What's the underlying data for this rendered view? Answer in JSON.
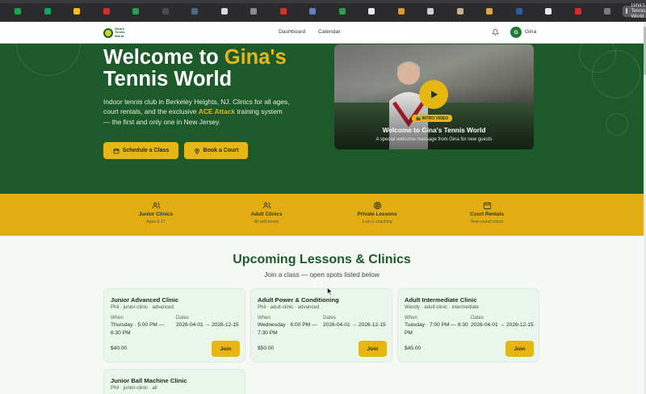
{
  "browser": {
    "active_tab_title": "Gina's Tennis World...",
    "tab_favicons": [
      "#1aa64a",
      "#0fa55a",
      "#f4c20d",
      "#d62b2b",
      "#2a9a55",
      "#4a4a52",
      "#4a6a8a",
      "#d9d9d9",
      "#8a8a8a",
      "#d93025",
      "#5e7fc2",
      "#2f9e4a",
      "#eaeaea",
      "#d89b2a",
      "#cfcfcf",
      "#c9b08a",
      "#e2a93a",
      "#2a5e9e",
      "#e8e8e8",
      "#d62b2b",
      "#7a7a7a"
    ]
  },
  "header": {
    "logo_text": "Gina's Tennis World",
    "nav": [
      "Dashboard",
      "Calendar"
    ],
    "user_initial": "G",
    "user_name": "Gina"
  },
  "hero": {
    "title_white_1": "Welcome to ",
    "title_accent": "Gina's",
    "title_white_2": "Tennis World",
    "desc_before": "Indoor tennis club in Berkeley Heights, NJ. Clinics for all ages, court rentals, and the exclusive ",
    "desc_highlight": "ACE Attack",
    "desc_after": " training system — the first and only one in New Jersey.",
    "btn_schedule": "Schedule a Class",
    "btn_court": "Book a Court",
    "video_badge": "🎬 INTRO VIDEO",
    "video_title": "Welcome to Gina's Tennis World",
    "video_subtitle": "A special welcome message from Gina for new guests"
  },
  "features": [
    {
      "title": "Junior Clinics",
      "sub": "Ages 6-17",
      "icon": "users-icon"
    },
    {
      "title": "Adult Clinics",
      "sub": "All skill levels",
      "icon": "users-icon"
    },
    {
      "title": "Private Lessons",
      "sub": "1-on-1 coaching",
      "icon": "target-icon"
    },
    {
      "title": "Court Rentals",
      "sub": "Year-round indoor",
      "icon": "calendar-icon"
    }
  ],
  "lessons": {
    "heading": "Upcoming Lessons & Clinics",
    "subheading": "Join a class — open spots listed below",
    "when_label": "When",
    "dates_label": "Dates",
    "join_label": "Join",
    "cards": [
      {
        "title": "Junior Advanced Clinic",
        "meta": "Phil · junior-clinic · advanced",
        "when": "Thursday · 5:00 PM — 6:30 PM",
        "dates": "2026-04-01 → 2026-12-15",
        "price": "$40.00"
      },
      {
        "title": "Adult Power & Conditioning",
        "meta": "Phil · adult-clinic · advanced",
        "when": "Wednesday · 6:00 PM — 7:30 PM",
        "dates": "2026-04-01 → 2026-12-15",
        "price": "$50.00"
      },
      {
        "title": "Adult Intermediate Clinic",
        "meta": "Wendy · adult-clinic · intermediate",
        "when": "Tuesday · 7:00 PM — 8:30 PM",
        "dates": "2026-04-01 → 2026-12-15",
        "price": "$45.00"
      },
      {
        "title": "Junior Ball Machine Clinic",
        "meta": "Phil · junior-clinic · all"
      }
    ]
  },
  "colors": {
    "brand_green": "#1d5a2a",
    "accent_gold": "#e6b614",
    "band_gold": "#e2ad12"
  }
}
